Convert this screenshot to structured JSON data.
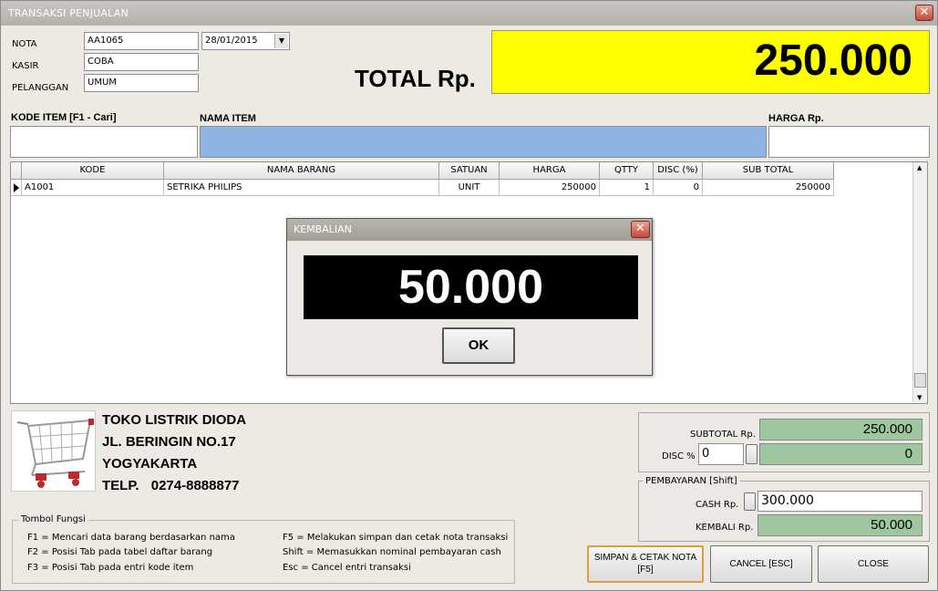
{
  "window": {
    "title": "TRANSAKSI PENJUALAN"
  },
  "header": {
    "nota_label": "NOTA",
    "nota_value": "AA1065",
    "date_value": "28/01/2015",
    "kasir_label": "KASIR",
    "kasir_value": "COBA",
    "pelanggan_label": "PELANGGAN",
    "pelanggan_value": "UMUM",
    "total_label": "TOTAL Rp.",
    "total_value": "250.000"
  },
  "entry": {
    "kode_label": "KODE ITEM  [F1 - Cari]",
    "nama_label": "NAMA ITEM",
    "harga_label": "HARGA Rp.",
    "kode_value": "",
    "nama_value": "",
    "harga_value": ""
  },
  "table": {
    "columns": [
      "KODE",
      "NAMA BARANG",
      "SATUAN",
      "HARGA",
      "QTTY",
      "DISC (%)",
      "SUB TOTAL"
    ],
    "rows": [
      [
        "A1001",
        "SETRIKA PHILIPS",
        "UNIT",
        "250000",
        "1",
        "0",
        "250000"
      ]
    ]
  },
  "dialog": {
    "title": "KEMBALIAN",
    "value": "50.000",
    "ok_label": "OK"
  },
  "store": {
    "name": "TOKO LISTRIK DIODA",
    "address": "JL. BERINGIN NO.17",
    "city": "YOGYAKARTA",
    "phone_label": "TELP.",
    "phone": "0274-8888877"
  },
  "summary": {
    "subtotal_label": "SUBTOTAL Rp.",
    "subtotal_value": "250.000",
    "disc_label": "DISC %",
    "disc_input": "0",
    "disc_value": "0"
  },
  "payment": {
    "group_label": "PEMBAYARAN [Shift]",
    "cash_label": "CASH Rp.",
    "cash_value": "300.000",
    "kembali_label": "KEMBALI Rp.",
    "kembali_value": "50.000"
  },
  "shortcuts": {
    "group_label": "Tombol Fungsi",
    "left": [
      "F1 = Mencari data barang berdasarkan nama",
      "F2 = Posisi Tab pada tabel daftar barang",
      "F3 = Posisi Tab pada entri kode item"
    ],
    "right": [
      "F5 = Melakukan simpan dan cetak nota transaksi",
      "Shift = Memasukkan nominal pembayaran cash",
      "Esc = Cancel entri transaksi"
    ]
  },
  "buttons": {
    "save_line1": "SIMPAN & CETAK NOTA",
    "save_line2": "[F5]",
    "cancel": "CANCEL [ESC]",
    "close": "CLOSE"
  },
  "colors": {
    "total_bg": "#ffff00",
    "item_name_bg": "#8eb4e3",
    "green_field": "#9fc79f",
    "change_bg": "#000000"
  }
}
